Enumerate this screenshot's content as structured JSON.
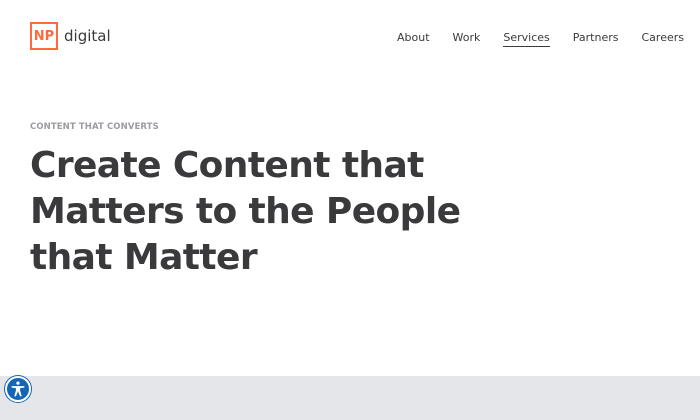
{
  "header": {
    "logo": {
      "mark": "NP",
      "text": "digital"
    },
    "nav": [
      {
        "label": "About",
        "active": false
      },
      {
        "label": "Work",
        "active": false
      },
      {
        "label": "Services",
        "active": true
      },
      {
        "label": "Partners",
        "active": false
      },
      {
        "label": "Careers",
        "active": false
      }
    ]
  },
  "hero": {
    "eyebrow": "CONTENT THAT CONVERTS",
    "headline_lines": [
      "Create Content that",
      "Matters to the People",
      "that Matter"
    ]
  },
  "accessibility": {
    "icon": "accessibility-icon"
  },
  "colors": {
    "brand_orange": "#ff6a3d",
    "text_dark": "#3a3a3c",
    "eyebrow_gray": "#9b9ba0",
    "band_gray": "#e4e6e9",
    "a11y_blue": "#1465b6"
  }
}
